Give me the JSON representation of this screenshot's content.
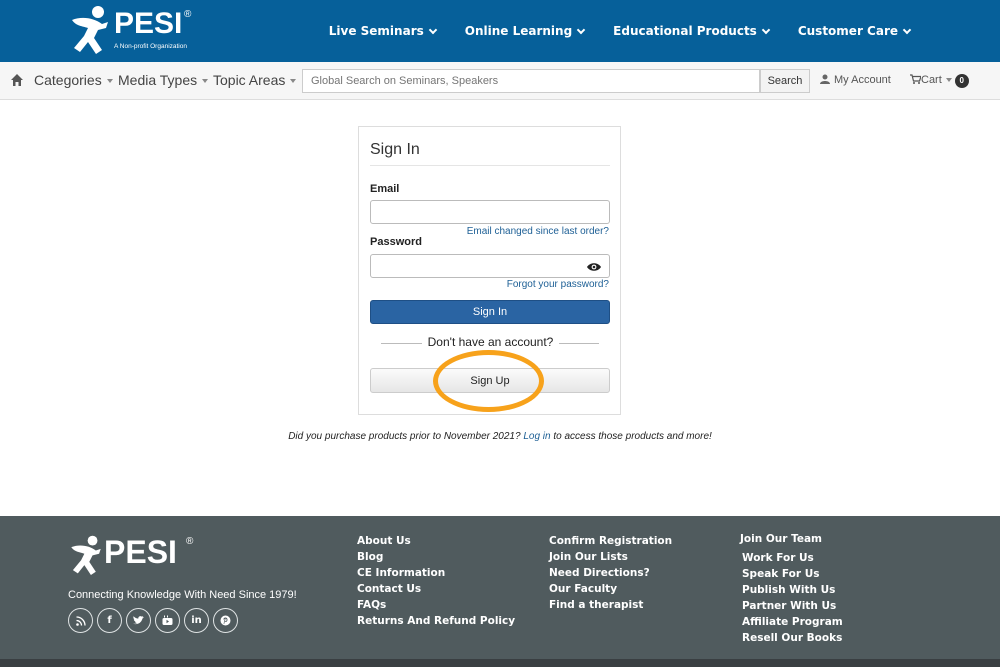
{
  "header": {
    "logo_word": "PESI",
    "logo_reg": "®",
    "logo_tagline": "A Non-profit Organization",
    "nav": [
      {
        "label": "Live Seminars"
      },
      {
        "label": "Online Learning"
      },
      {
        "label": "Educational Products"
      },
      {
        "label": "Customer Care"
      }
    ]
  },
  "subbar": {
    "categories_label": "Categories",
    "media_types_label": "Media Types",
    "topic_areas_label": "Topic Areas",
    "search_placeholder": "Global Search on Seminars, Speakers",
    "search_button": "Search",
    "account_label": "My Account",
    "cart_label": "Cart",
    "cart_count": "0"
  },
  "signin": {
    "title": "Sign In",
    "email_label": "Email",
    "email_value": "",
    "email_changed_link": "Email changed since last order?",
    "password_label": "Password",
    "password_value": "",
    "forgot_link": "Forgot your password?",
    "signin_button": "Sign In",
    "no_account_text": "Don't have an account?",
    "signup_button": "Sign Up"
  },
  "note": {
    "prefix": "Did you purchase products prior to November 2021?",
    "link": "Log in",
    "suffix": "to access those products and more!"
  },
  "footer": {
    "logo_word": "PESI",
    "logo_reg": "®",
    "tagline": "Connecting Knowledge With Need Since 1979!",
    "socials": [
      "rss-icon",
      "facebook-icon",
      "twitter-icon",
      "youtube-icon",
      "linkedin-icon",
      "pinterest-icon"
    ],
    "col1": [
      "About Us",
      "Blog",
      "CE Information",
      "Contact Us",
      "FAQs",
      "Returns And Refund Policy"
    ],
    "col2": [
      "Confirm Registration",
      "Join Our Lists",
      "Need Directions?",
      "Our Faculty",
      "Find a therapist"
    ],
    "col3_heading": "Join Our Team",
    "col3": [
      "Work For Us",
      "Speak For Us",
      "Publish With Us",
      "Partner With Us",
      "Affiliate Program",
      "Resell Our Books"
    ]
  },
  "colors": {
    "header_bg": "#06609a",
    "footer_bg": "#505b5e",
    "primary_button": "#2a64a3",
    "highlight_ring": "#f7a21b",
    "link": "#1d5f95"
  }
}
